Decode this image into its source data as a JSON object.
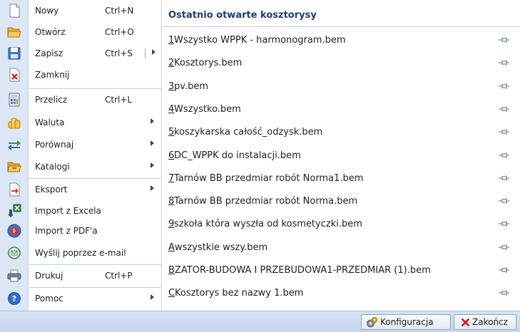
{
  "left_menu": {
    "items": [
      {
        "label": "Nowy",
        "shortcut": "Ctrl+N",
        "icon": "new-document-icon"
      },
      {
        "label": "Otwórz",
        "shortcut": "Ctrl+O",
        "icon": "open-folder-icon"
      },
      {
        "label": "Zapisz",
        "shortcut": "Ctrl+S",
        "icon": "save-disk-icon"
      },
      {
        "label": "Zamknij",
        "shortcut": "",
        "icon": "close-document-icon"
      },
      {
        "label": "Przelicz",
        "shortcut": "Ctrl+L",
        "icon": "calculator-icon"
      },
      {
        "label": "Waluta",
        "shortcut": "",
        "icon": "coins-icon"
      },
      {
        "label": "Porównaj",
        "shortcut": "",
        "icon": "compare-arrows-icon"
      },
      {
        "label": "Katalogi",
        "shortcut": "",
        "icon": "catalog-folder-icon"
      },
      {
        "label": "Eksport",
        "shortcut": "",
        "icon": "export-icon"
      },
      {
        "label": "Import z Excela",
        "shortcut": "",
        "icon": "import-excel-icon"
      },
      {
        "label": "Import z PDF'a",
        "shortcut": "",
        "icon": "import-pdf-icon"
      },
      {
        "label": "Wyślij poprzez e-mail",
        "shortcut": "",
        "icon": "email-icon"
      },
      {
        "label": "Drukuj",
        "shortcut": "Ctrl+P",
        "icon": "printer-icon"
      },
      {
        "label": "Pomoc",
        "shortcut": "",
        "icon": "help-icon"
      }
    ]
  },
  "recent": {
    "title": "Ostatnio otwarte kosztorysy",
    "items": [
      {
        "key": "1",
        "name": " Wszystko WPPK - harmonogram.bem"
      },
      {
        "key": "2",
        "name": " Kosztorys.bem"
      },
      {
        "key": "3",
        "name": " pv.bem"
      },
      {
        "key": "4",
        "name": " Wszystko.bem"
      },
      {
        "key": "5",
        "name": " koszykarska całość_odzysk.bem"
      },
      {
        "key": "6",
        "name": " DC_WPPK do instalacji.bem"
      },
      {
        "key": "7",
        "name": " Tarnów BB przedmiar robót Norma1.bem"
      },
      {
        "key": "8",
        "name": " Tarnów BB przedmiar robót Norma.bem"
      },
      {
        "key": "9",
        "name": " szkoła która wyszła od kosmetyczki.bem"
      },
      {
        "key": "A",
        "name": " wszystkie wszy.bem"
      },
      {
        "key": "B",
        "name": " ZATOR-BUDOWA I PRZEBUDOWA1-PRZEDMIAR (1).bem"
      },
      {
        "key": "C",
        "name": " Kosztorys bez nazwy 1.bem"
      }
    ]
  },
  "bottom_bar": {
    "config_label": "Konfiguracja",
    "close_label": "Zakończ"
  },
  "colors": {
    "accent": "#1e3d6e",
    "gutter": "#dce6f4",
    "close_x": "#d01818"
  }
}
